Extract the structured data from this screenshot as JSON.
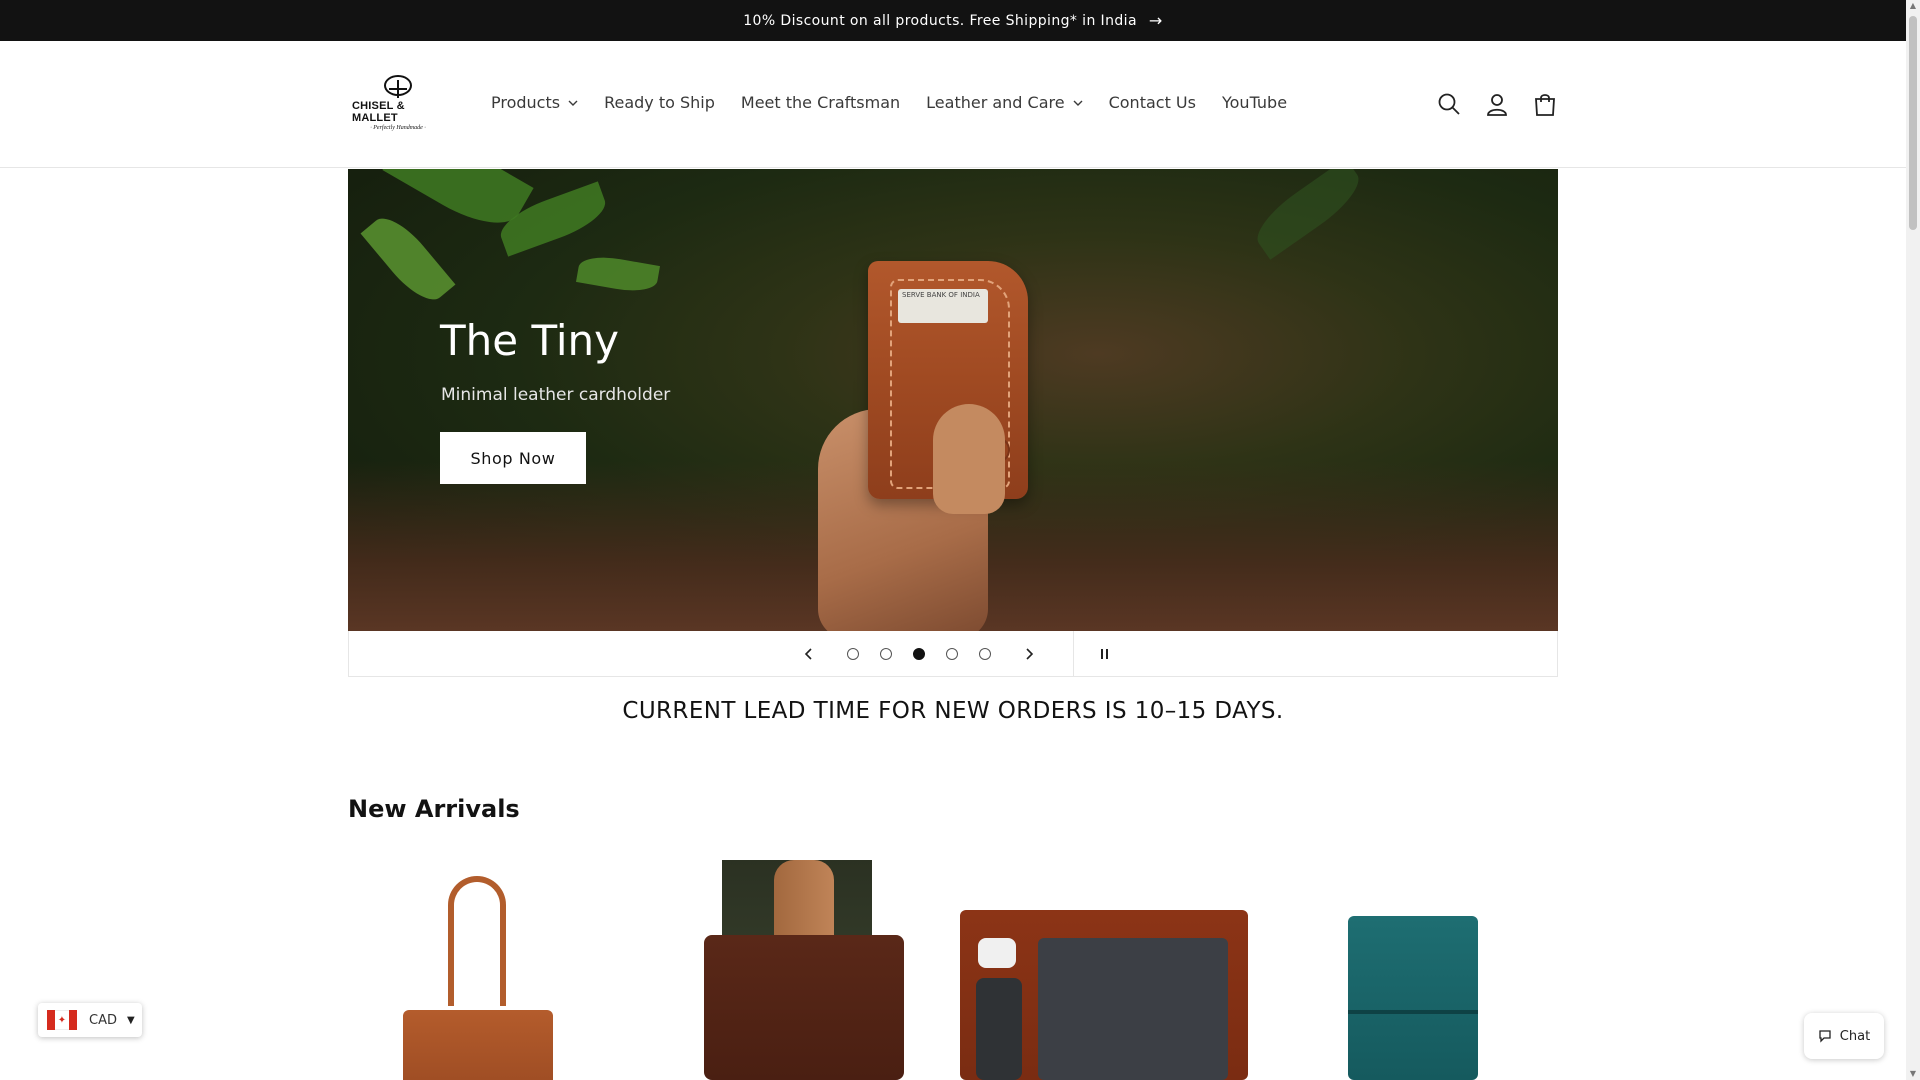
{
  "announcement": {
    "text": "10% Discount on all products. Free Shipping* in India",
    "arrow": "→",
    "icon": "arrow-right-icon"
  },
  "header": {
    "logo": {
      "text": "CHISEL & MALLET",
      "tagline": "· Perfectly Handmade ·"
    },
    "nav": [
      {
        "label": "Products",
        "has_dropdown": true
      },
      {
        "label": "Ready to Ship",
        "has_dropdown": false
      },
      {
        "label": "Meet the Craftsman",
        "has_dropdown": false
      },
      {
        "label": "Leather and Care",
        "has_dropdown": true
      },
      {
        "label": "Contact Us",
        "has_dropdown": false
      },
      {
        "label": "YouTube",
        "has_dropdown": false
      }
    ],
    "icons": [
      "search-icon",
      "account-icon",
      "cart-icon"
    ]
  },
  "hero": {
    "title": "The Tiny",
    "subtitle": "Minimal leather cardholder",
    "button_label": "Shop Now",
    "note_text": "SERVE BANK OF INDIA"
  },
  "slider": {
    "prev_icon": "‹",
    "next_icon": "›",
    "slide_count": 5,
    "active_slide": 3
  },
  "lead_time": {
    "text": "CURRENT LEAD TIME FOR NEW ORDERS IS 10–15 DAYS."
  },
  "new_arrivals": {
    "title": "New Arrivals"
  },
  "currency": {
    "code": "CAD",
    "caret": "▼",
    "flag_leaf": "✦"
  },
  "chat": {
    "label": "Chat"
  },
  "colors": {
    "announcement_bg": "#121212",
    "accent": "#121212",
    "leather_tan": "#b25d2c",
    "leather_teal": "#1e6e72"
  }
}
